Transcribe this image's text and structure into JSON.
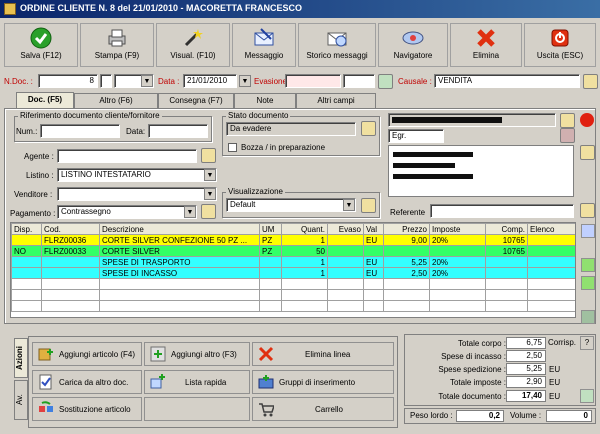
{
  "window": {
    "title": "ORDINE CLIENTE N. 8  del 21/01/2010 - MACORETTA FRANCESCO"
  },
  "toolbar": [
    {
      "label": "Salva (F12)",
      "icon": "check-icon"
    },
    {
      "label": "Stampa (F9)",
      "icon": "printer-icon"
    },
    {
      "label": "Visual. (F10)",
      "icon": "magic-wand-icon"
    },
    {
      "label": "Messaggio",
      "icon": "envelope-icon"
    },
    {
      "label": "Storico messaggi",
      "icon": "message-history-icon"
    },
    {
      "label": "Navigatore",
      "icon": "navigator-icon"
    },
    {
      "label": "Elimina",
      "icon": "delete-x-icon"
    },
    {
      "label": "Uscita (ESC)",
      "icon": "exit-icon"
    }
  ],
  "header": {
    "ndoc_label": "N.Doc. :",
    "ndoc_value": "8",
    "data_label": "Data :",
    "data_value": "21/01/2010",
    "evasione_label": "Evasione:",
    "evasione_value": "",
    "causale_label": "Causale :",
    "causale_value": "VENDITA"
  },
  "tabs": [
    "Doc. (F5)",
    "Altro (F6)",
    "Consegna (F7)",
    "Note",
    "Altri campi"
  ],
  "doc": {
    "rif_title": "Riferimento documento cliente/fornitore",
    "num_label": "Num.:",
    "data_label": "Data:",
    "agente_label": "Agente :",
    "listino_label": "Listino :",
    "listino_value": "LISTINO INTESTATARIO",
    "venditore_label": "Venditore :",
    "pagamento_label": "Pagamento :",
    "pagamento_value": "Contrassegno",
    "stato_title": "Stato documento",
    "stato_value": "Da evadere",
    "bozza_label": "Bozza / in preparazione",
    "visual_title": "Visualizzazione",
    "visual_value": "Default",
    "cliente_line2": "Egr.",
    "referente_label": "Referente"
  },
  "grid": {
    "headers": [
      "Disp.",
      "Cod.",
      "Descrizione",
      "UM",
      "Quant.",
      "Evaso",
      "Val",
      "Prezzo",
      "Imposte",
      "Comp.",
      "Elenco"
    ],
    "rows": [
      {
        "disp": "",
        "cod": "FLRZ00036",
        "desc": "CORTE SILVER CONFEZIONE 50 PZ ...",
        "um": "PZ",
        "qty": "1",
        "evaso": "",
        "val": "EU",
        "prezzo": "9,00",
        "imposte": "20%",
        "comp": "10765",
        "color": "#ffff00"
      },
      {
        "disp": "NO",
        "cod": "FLRZ00033",
        "desc": "CORTE SILVER",
        "um": "PZ",
        "qty": "50",
        "evaso": "",
        "val": "",
        "prezzo": "",
        "imposte": "",
        "comp": "10765",
        "color": "#33ff66"
      },
      {
        "disp": "",
        "cod": "",
        "desc": "SPESE DI TRASPORTO",
        "um": "",
        "qty": "1",
        "evaso": "",
        "val": "EU",
        "prezzo": "5,25",
        "imposte": "20%",
        "comp": "",
        "color": "#33ffff"
      },
      {
        "disp": "",
        "cod": "",
        "desc": "SPESE DI INCASSO",
        "um": "",
        "qty": "1",
        "evaso": "",
        "val": "EU",
        "prezzo": "2,50",
        "imposte": "20%",
        "comp": "",
        "color": "#33ffff"
      }
    ]
  },
  "actions": {
    "side_tabs": [
      "Azioni",
      "Av."
    ],
    "buttons": [
      {
        "label": "Aggiungi articolo (F4)",
        "icon": "add-article-icon"
      },
      {
        "label": "Aggiungi altro (F3)",
        "icon": "add-other-icon"
      },
      {
        "label": "Elimina linea",
        "icon": "delete-line-icon"
      },
      {
        "label": "Carica da altro doc.",
        "icon": "load-doc-icon"
      },
      {
        "label": "Lista rapida",
        "icon": "quick-list-icon"
      },
      {
        "label": "Gruppi di inserimento",
        "icon": "insert-groups-icon"
      },
      {
        "label": "Sostituzione articolo",
        "icon": "replace-article-icon"
      },
      {
        "label": "",
        "icon": ""
      },
      {
        "label": "Carrello",
        "icon": "cart-icon"
      }
    ]
  },
  "totals": {
    "corpo_label": "Totale corpo :",
    "corpo_value": "6,75",
    "corrisp_label": "Corrisp.",
    "help_label": "?",
    "incasso_label": "Spese di incasso :",
    "incasso_value": "2,50",
    "spedizione_label": "Spese spedizione :",
    "spedizione_value": "5,25",
    "spedizione_cur": "EU",
    "imposte_label": "Totale imposte :",
    "imposte_value": "2,90",
    "imposte_cur": "EU",
    "documento_label": "Totale documento :",
    "documento_value": "17,40",
    "documento_cur": "EU",
    "peso_label": "Peso lordo :",
    "peso_value": "0,2",
    "volume_label": "Volume :",
    "volume_value": "0"
  }
}
